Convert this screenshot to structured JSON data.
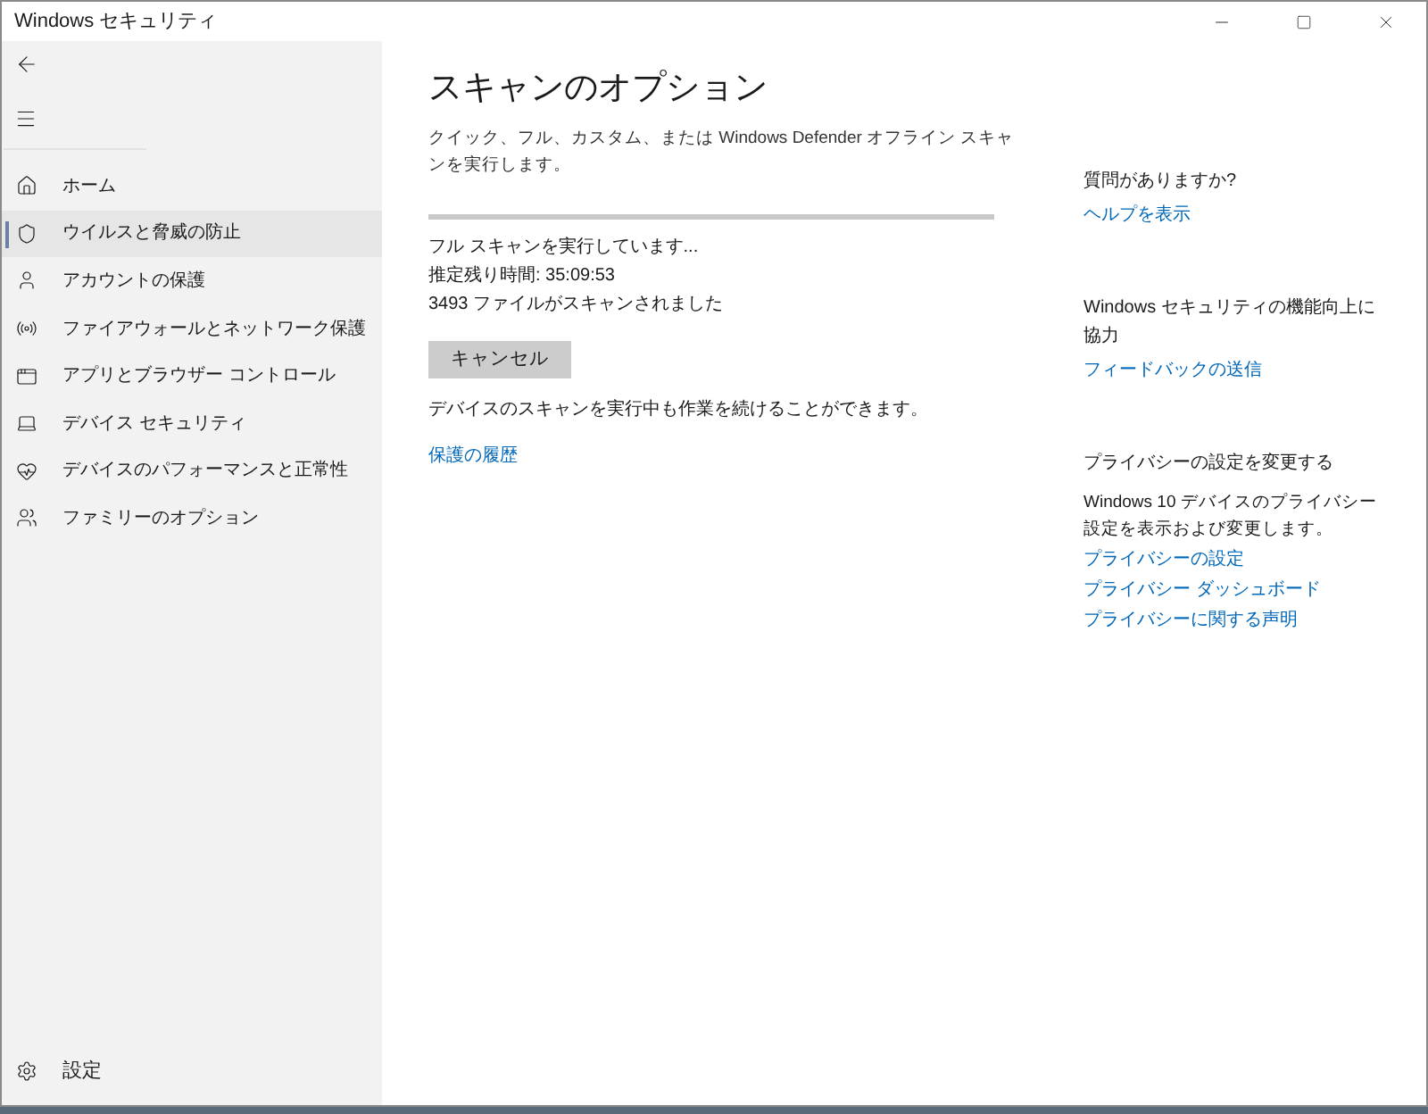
{
  "window": {
    "title": "Windows セキュリティ"
  },
  "sidebar": {
    "items": [
      {
        "label": "ホーム",
        "selected": false
      },
      {
        "label": "ウイルスと脅威の防止",
        "selected": true
      },
      {
        "label": "アカウントの保護",
        "selected": false
      },
      {
        "label": "ファイアウォールとネットワーク保護",
        "selected": false
      },
      {
        "label": "アプリとブラウザー コントロール",
        "selected": false
      },
      {
        "label": "デバイス セキュリティ",
        "selected": false
      },
      {
        "label": "デバイスのパフォーマンスと正常性",
        "selected": false
      },
      {
        "label": "ファミリーのオプション",
        "selected": false
      }
    ],
    "settings": "設定"
  },
  "main": {
    "title": "スキャンのオプション",
    "description": "クイック、フル、カスタム、または Windows Defender オフライン スキャンを実行します。",
    "status_lines": [
      "フル スキャンを実行しています...",
      "推定残り時間: 35:09:53",
      "3493 ファイルがスキャンされました"
    ],
    "cancel_button": "キャンセル",
    "note": "デバイスのスキャンを実行中も作業を続けることができます。",
    "history_link": "保護の履歴"
  },
  "aside": [
    {
      "heading": "質問がありますか?",
      "links": [
        "ヘルプを表示"
      ]
    },
    {
      "heading": "Windows セキュリティの機能向上に協力",
      "links": [
        "フィードバックの送信"
      ]
    },
    {
      "heading": "プライバシーの設定を変更する",
      "text": "Windows 10 デバイスのプライバシー設定を表示および変更します。",
      "links": [
        "プライバシーの設定",
        "プライバシー ダッシュボード",
        "プライバシーに関する声明"
      ]
    }
  ]
}
